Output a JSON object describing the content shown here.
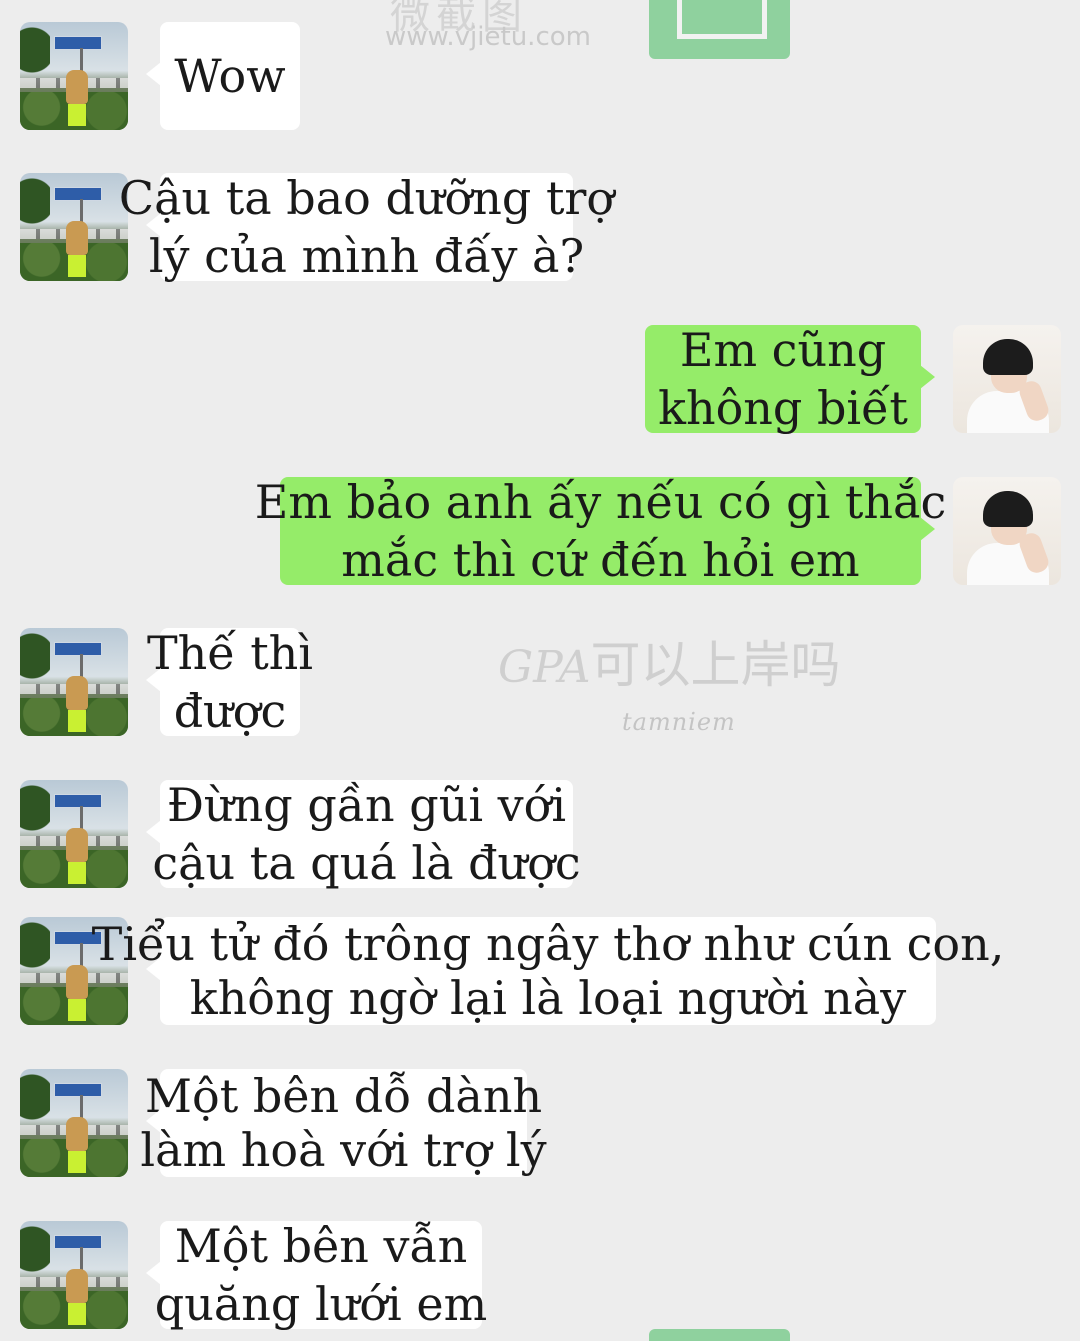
{
  "watermarks": {
    "top_url": "www.vjietu.com",
    "top_glyphs": "微截图",
    "mid_gpa": "GPA",
    "mid_cn": "可以上岸吗",
    "credit": "tamniem"
  },
  "colors": {
    "background": "#ededed",
    "incoming_bubble": "#ffffff",
    "outgoing_bubble": "#95ec69"
  },
  "messages": [
    {
      "sender": "other",
      "lines": [
        "Wow"
      ]
    },
    {
      "sender": "other",
      "lines": [
        "Cậu ta bao dưỡng trợ",
        "lý của mình đấy à?"
      ]
    },
    {
      "sender": "me",
      "lines": [
        "Em cũng",
        "không biết"
      ]
    },
    {
      "sender": "me",
      "lines": [
        "Em bảo anh ấy nếu có gì thắc",
        "mắc thì cứ đến hỏi em"
      ]
    },
    {
      "sender": "other",
      "lines": [
        "Thế thì",
        "được"
      ]
    },
    {
      "sender": "other",
      "lines": [
        "Đừng gần gũi với",
        "cậu ta quá là được"
      ]
    },
    {
      "sender": "other",
      "lines": [
        "Tiểu tử đó trông ngây thơ như cún con,",
        "không ngờ lại là loại người này"
      ]
    },
    {
      "sender": "other",
      "lines": [
        "Một bên dỗ dành",
        "làm hoà với trợ lý"
      ]
    },
    {
      "sender": "other",
      "lines": [
        "Một bên vẫn",
        "quăng lưới em"
      ]
    }
  ]
}
